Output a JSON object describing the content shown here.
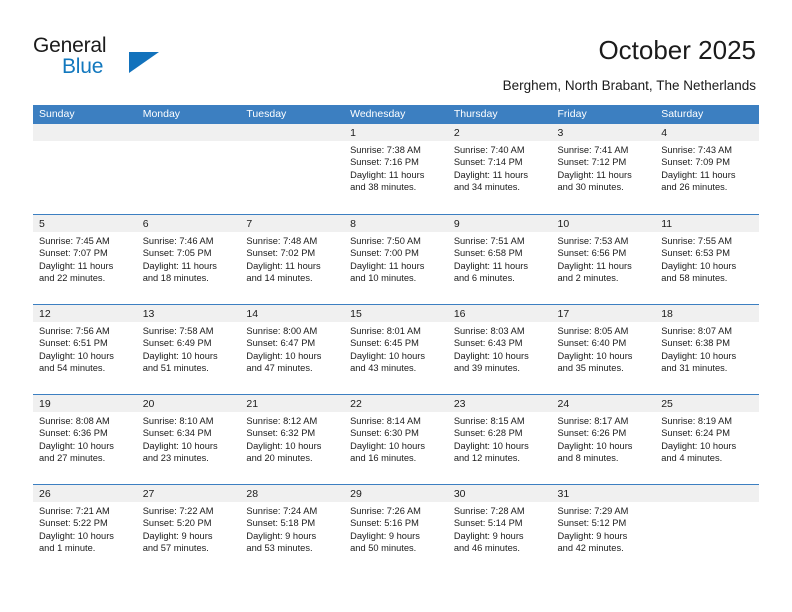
{
  "brand": {
    "name_part1": "General",
    "name_part2": "Blue",
    "triangle_color": "#1272bc"
  },
  "header": {
    "title": "October 2025",
    "location": "Berghem, North Brabant, The Netherlands"
  },
  "calendar": {
    "header_color": "#3c7fc1",
    "daynum_band_color": "#f0f0f0",
    "weekday_names": [
      "Sunday",
      "Monday",
      "Tuesday",
      "Wednesday",
      "Thursday",
      "Friday",
      "Saturday"
    ],
    "weeks": [
      [
        {
          "day": "",
          "empty": true
        },
        {
          "day": "",
          "empty": true
        },
        {
          "day": "",
          "empty": true
        },
        {
          "day": "1",
          "sunrise": "Sunrise: 7:38 AM",
          "sunset": "Sunset: 7:16 PM",
          "daylight_line1": "Daylight: 11 hours",
          "daylight_line2": "and 38 minutes."
        },
        {
          "day": "2",
          "sunrise": "Sunrise: 7:40 AM",
          "sunset": "Sunset: 7:14 PM",
          "daylight_line1": "Daylight: 11 hours",
          "daylight_line2": "and 34 minutes."
        },
        {
          "day": "3",
          "sunrise": "Sunrise: 7:41 AM",
          "sunset": "Sunset: 7:12 PM",
          "daylight_line1": "Daylight: 11 hours",
          "daylight_line2": "and 30 minutes."
        },
        {
          "day": "4",
          "sunrise": "Sunrise: 7:43 AM",
          "sunset": "Sunset: 7:09 PM",
          "daylight_line1": "Daylight: 11 hours",
          "daylight_line2": "and 26 minutes."
        }
      ],
      [
        {
          "day": "5",
          "sunrise": "Sunrise: 7:45 AM",
          "sunset": "Sunset: 7:07 PM",
          "daylight_line1": "Daylight: 11 hours",
          "daylight_line2": "and 22 minutes."
        },
        {
          "day": "6",
          "sunrise": "Sunrise: 7:46 AM",
          "sunset": "Sunset: 7:05 PM",
          "daylight_line1": "Daylight: 11 hours",
          "daylight_line2": "and 18 minutes."
        },
        {
          "day": "7",
          "sunrise": "Sunrise: 7:48 AM",
          "sunset": "Sunset: 7:02 PM",
          "daylight_line1": "Daylight: 11 hours",
          "daylight_line2": "and 14 minutes."
        },
        {
          "day": "8",
          "sunrise": "Sunrise: 7:50 AM",
          "sunset": "Sunset: 7:00 PM",
          "daylight_line1": "Daylight: 11 hours",
          "daylight_line2": "and 10 minutes."
        },
        {
          "day": "9",
          "sunrise": "Sunrise: 7:51 AM",
          "sunset": "Sunset: 6:58 PM",
          "daylight_line1": "Daylight: 11 hours",
          "daylight_line2": "and 6 minutes."
        },
        {
          "day": "10",
          "sunrise": "Sunrise: 7:53 AM",
          "sunset": "Sunset: 6:56 PM",
          "daylight_line1": "Daylight: 11 hours",
          "daylight_line2": "and 2 minutes."
        },
        {
          "day": "11",
          "sunrise": "Sunrise: 7:55 AM",
          "sunset": "Sunset: 6:53 PM",
          "daylight_line1": "Daylight: 10 hours",
          "daylight_line2": "and 58 minutes."
        }
      ],
      [
        {
          "day": "12",
          "sunrise": "Sunrise: 7:56 AM",
          "sunset": "Sunset: 6:51 PM",
          "daylight_line1": "Daylight: 10 hours",
          "daylight_line2": "and 54 minutes."
        },
        {
          "day": "13",
          "sunrise": "Sunrise: 7:58 AM",
          "sunset": "Sunset: 6:49 PM",
          "daylight_line1": "Daylight: 10 hours",
          "daylight_line2": "and 51 minutes."
        },
        {
          "day": "14",
          "sunrise": "Sunrise: 8:00 AM",
          "sunset": "Sunset: 6:47 PM",
          "daylight_line1": "Daylight: 10 hours",
          "daylight_line2": "and 47 minutes."
        },
        {
          "day": "15",
          "sunrise": "Sunrise: 8:01 AM",
          "sunset": "Sunset: 6:45 PM",
          "daylight_line1": "Daylight: 10 hours",
          "daylight_line2": "and 43 minutes."
        },
        {
          "day": "16",
          "sunrise": "Sunrise: 8:03 AM",
          "sunset": "Sunset: 6:43 PM",
          "daylight_line1": "Daylight: 10 hours",
          "daylight_line2": "and 39 minutes."
        },
        {
          "day": "17",
          "sunrise": "Sunrise: 8:05 AM",
          "sunset": "Sunset: 6:40 PM",
          "daylight_line1": "Daylight: 10 hours",
          "daylight_line2": "and 35 minutes."
        },
        {
          "day": "18",
          "sunrise": "Sunrise: 8:07 AM",
          "sunset": "Sunset: 6:38 PM",
          "daylight_line1": "Daylight: 10 hours",
          "daylight_line2": "and 31 minutes."
        }
      ],
      [
        {
          "day": "19",
          "sunrise": "Sunrise: 8:08 AM",
          "sunset": "Sunset: 6:36 PM",
          "daylight_line1": "Daylight: 10 hours",
          "daylight_line2": "and 27 minutes."
        },
        {
          "day": "20",
          "sunrise": "Sunrise: 8:10 AM",
          "sunset": "Sunset: 6:34 PM",
          "daylight_line1": "Daylight: 10 hours",
          "daylight_line2": "and 23 minutes."
        },
        {
          "day": "21",
          "sunrise": "Sunrise: 8:12 AM",
          "sunset": "Sunset: 6:32 PM",
          "daylight_line1": "Daylight: 10 hours",
          "daylight_line2": "and 20 minutes."
        },
        {
          "day": "22",
          "sunrise": "Sunrise: 8:14 AM",
          "sunset": "Sunset: 6:30 PM",
          "daylight_line1": "Daylight: 10 hours",
          "daylight_line2": "and 16 minutes."
        },
        {
          "day": "23",
          "sunrise": "Sunrise: 8:15 AM",
          "sunset": "Sunset: 6:28 PM",
          "daylight_line1": "Daylight: 10 hours",
          "daylight_line2": "and 12 minutes."
        },
        {
          "day": "24",
          "sunrise": "Sunrise: 8:17 AM",
          "sunset": "Sunset: 6:26 PM",
          "daylight_line1": "Daylight: 10 hours",
          "daylight_line2": "and 8 minutes."
        },
        {
          "day": "25",
          "sunrise": "Sunrise: 8:19 AM",
          "sunset": "Sunset: 6:24 PM",
          "daylight_line1": "Daylight: 10 hours",
          "daylight_line2": "and 4 minutes."
        }
      ],
      [
        {
          "day": "26",
          "sunrise": "Sunrise: 7:21 AM",
          "sunset": "Sunset: 5:22 PM",
          "daylight_line1": "Daylight: 10 hours",
          "daylight_line2": "and 1 minute."
        },
        {
          "day": "27",
          "sunrise": "Sunrise: 7:22 AM",
          "sunset": "Sunset: 5:20 PM",
          "daylight_line1": "Daylight: 9 hours",
          "daylight_line2": "and 57 minutes."
        },
        {
          "day": "28",
          "sunrise": "Sunrise: 7:24 AM",
          "sunset": "Sunset: 5:18 PM",
          "daylight_line1": "Daylight: 9 hours",
          "daylight_line2": "and 53 minutes."
        },
        {
          "day": "29",
          "sunrise": "Sunrise: 7:26 AM",
          "sunset": "Sunset: 5:16 PM",
          "daylight_line1": "Daylight: 9 hours",
          "daylight_line2": "and 50 minutes."
        },
        {
          "day": "30",
          "sunrise": "Sunrise: 7:28 AM",
          "sunset": "Sunset: 5:14 PM",
          "daylight_line1": "Daylight: 9 hours",
          "daylight_line2": "and 46 minutes."
        },
        {
          "day": "31",
          "sunrise": "Sunrise: 7:29 AM",
          "sunset": "Sunset: 5:12 PM",
          "daylight_line1": "Daylight: 9 hours",
          "daylight_line2": "and 42 minutes."
        },
        {
          "day": "",
          "empty": true
        }
      ]
    ]
  }
}
